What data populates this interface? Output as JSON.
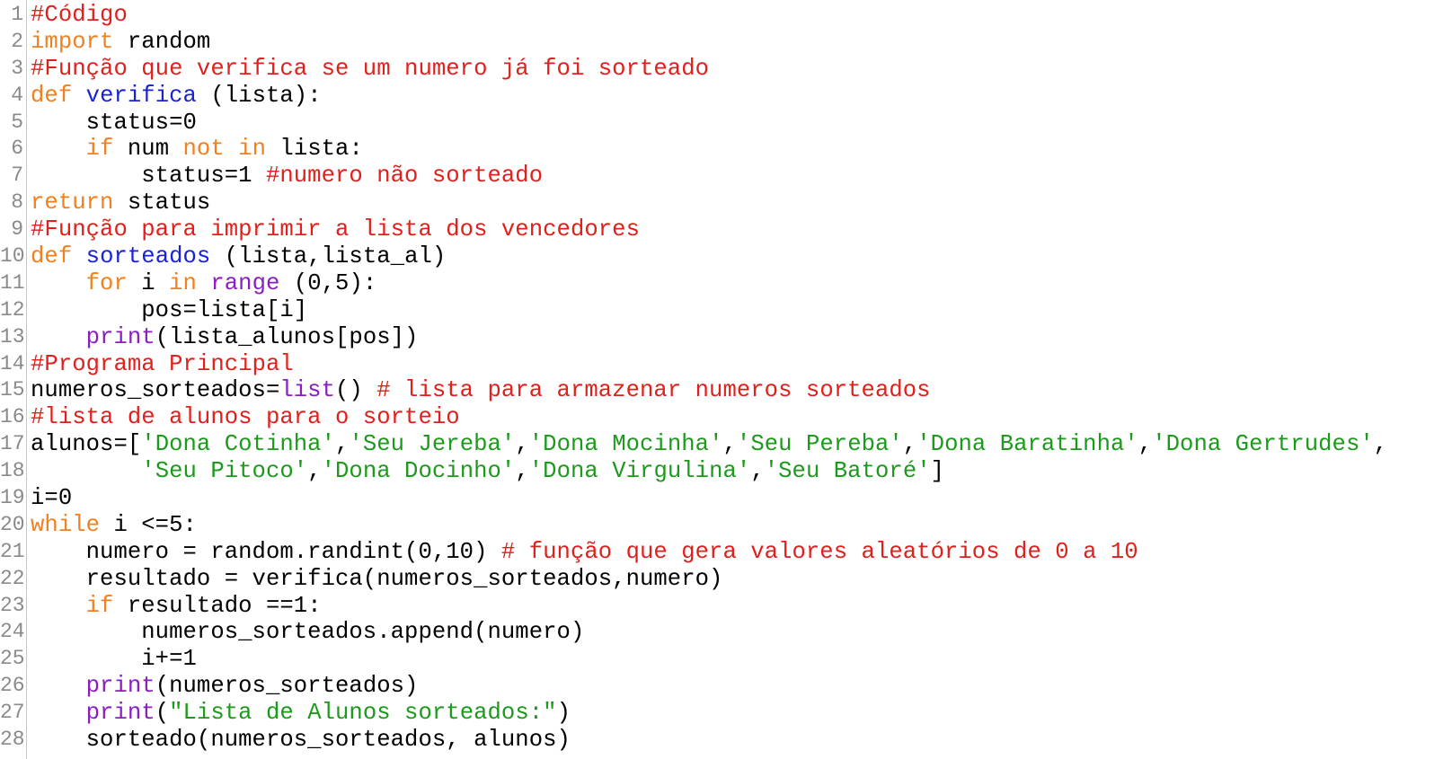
{
  "colors": {
    "comment": "#e0201c",
    "keyword": "#f08020",
    "funcname": "#1a22d8",
    "builtin": "#8a1ec0",
    "string": "#1c9a1c",
    "plain": "#000000",
    "line_number": "#8a8a8a"
  },
  "editor": {
    "lines": [
      {
        "number": "1",
        "tokens": [
          {
            "t": "comment",
            "s": "#Código"
          }
        ]
      },
      {
        "number": "2",
        "tokens": [
          {
            "t": "keyword",
            "s": "import"
          },
          {
            "t": "plain",
            "s": " random"
          }
        ]
      },
      {
        "number": "3",
        "tokens": [
          {
            "t": "comment",
            "s": "#Função que verifica se um numero já foi sorteado"
          }
        ]
      },
      {
        "number": "4",
        "tokens": [
          {
            "t": "keyword",
            "s": "def"
          },
          {
            "t": "plain",
            "s": " "
          },
          {
            "t": "funcname",
            "s": "verifica"
          },
          {
            "t": "plain",
            "s": " (lista):"
          }
        ]
      },
      {
        "number": "5",
        "tokens": [
          {
            "t": "plain",
            "s": "    status=0"
          }
        ]
      },
      {
        "number": "6",
        "tokens": [
          {
            "t": "plain",
            "s": "    "
          },
          {
            "t": "keyword",
            "s": "if"
          },
          {
            "t": "plain",
            "s": " num "
          },
          {
            "t": "keyword",
            "s": "not"
          },
          {
            "t": "plain",
            "s": " "
          },
          {
            "t": "keyword",
            "s": "in"
          },
          {
            "t": "plain",
            "s": " lista:"
          }
        ]
      },
      {
        "number": "7",
        "tokens": [
          {
            "t": "plain",
            "s": "        status=1 "
          },
          {
            "t": "comment",
            "s": "#numero não sorteado"
          }
        ]
      },
      {
        "number": "8",
        "tokens": [
          {
            "t": "keyword",
            "s": "return"
          },
          {
            "t": "plain",
            "s": " status"
          }
        ]
      },
      {
        "number": "9",
        "tokens": [
          {
            "t": "comment",
            "s": "#Função para imprimir a lista dos vencedores"
          }
        ]
      },
      {
        "number": "10",
        "tokens": [
          {
            "t": "keyword",
            "s": "def"
          },
          {
            "t": "plain",
            "s": " "
          },
          {
            "t": "funcname",
            "s": "sorteados"
          },
          {
            "t": "plain",
            "s": " (lista,lista_al)"
          }
        ]
      },
      {
        "number": "11",
        "tokens": [
          {
            "t": "plain",
            "s": "    "
          },
          {
            "t": "keyword",
            "s": "for"
          },
          {
            "t": "plain",
            "s": " i "
          },
          {
            "t": "keyword",
            "s": "in"
          },
          {
            "t": "plain",
            "s": " "
          },
          {
            "t": "builtin",
            "s": "range"
          },
          {
            "t": "plain",
            "s": " (0,5):"
          }
        ]
      },
      {
        "number": "12",
        "tokens": [
          {
            "t": "plain",
            "s": "        pos=lista[i]"
          }
        ]
      },
      {
        "number": "13",
        "tokens": [
          {
            "t": "plain",
            "s": "    "
          },
          {
            "t": "builtin",
            "s": "print"
          },
          {
            "t": "plain",
            "s": "(lista_alunos[pos])"
          }
        ]
      },
      {
        "number": "14",
        "tokens": [
          {
            "t": "comment",
            "s": "#Programa Principal"
          }
        ]
      },
      {
        "number": "15",
        "tokens": [
          {
            "t": "plain",
            "s": "numeros_sorteados="
          },
          {
            "t": "builtin",
            "s": "list"
          },
          {
            "t": "plain",
            "s": "() "
          },
          {
            "t": "comment",
            "s": "# lista para armazenar numeros sorteados"
          }
        ]
      },
      {
        "number": "16",
        "tokens": [
          {
            "t": "comment",
            "s": "#lista de alunos para o sorteio"
          }
        ]
      },
      {
        "number": "17",
        "tokens": [
          {
            "t": "plain",
            "s": "alunos=["
          },
          {
            "t": "string",
            "s": "'Dona Cotinha'"
          },
          {
            "t": "plain",
            "s": ","
          },
          {
            "t": "string",
            "s": "'Seu Jereba'"
          },
          {
            "t": "plain",
            "s": ","
          },
          {
            "t": "string",
            "s": "'Dona Mocinha'"
          },
          {
            "t": "plain",
            "s": ","
          },
          {
            "t": "string",
            "s": "'Seu Pereba'"
          },
          {
            "t": "plain",
            "s": ","
          },
          {
            "t": "string",
            "s": "'Dona Baratinha'"
          },
          {
            "t": "plain",
            "s": ","
          },
          {
            "t": "string",
            "s": "'Dona Gertrudes'"
          },
          {
            "t": "plain",
            "s": ","
          }
        ]
      },
      {
        "number": "18",
        "tokens": [
          {
            "t": "plain",
            "s": "        "
          },
          {
            "t": "string",
            "s": "'Seu Pitoco'"
          },
          {
            "t": "plain",
            "s": ","
          },
          {
            "t": "string",
            "s": "'Dona Docinho'"
          },
          {
            "t": "plain",
            "s": ","
          },
          {
            "t": "string",
            "s": "'Dona Virgulina'"
          },
          {
            "t": "plain",
            "s": ","
          },
          {
            "t": "string",
            "s": "'Seu Batoré'"
          },
          {
            "t": "plain",
            "s": "]"
          }
        ]
      },
      {
        "number": "19",
        "tokens": [
          {
            "t": "plain",
            "s": "i=0"
          }
        ]
      },
      {
        "number": "20",
        "tokens": [
          {
            "t": "keyword",
            "s": "while"
          },
          {
            "t": "plain",
            "s": " i <=5:"
          }
        ]
      },
      {
        "number": "21",
        "tokens": [
          {
            "t": "plain",
            "s": "    numero = random.randint(0,10) "
          },
          {
            "t": "comment",
            "s": "# função que gera valores aleatórios de 0 a 10"
          }
        ]
      },
      {
        "number": "22",
        "tokens": [
          {
            "t": "plain",
            "s": "    resultado = verifica(numeros_sorteados,numero)"
          }
        ]
      },
      {
        "number": "23",
        "tokens": [
          {
            "t": "plain",
            "s": "    "
          },
          {
            "t": "keyword",
            "s": "if"
          },
          {
            "t": "plain",
            "s": " resultado ==1:"
          }
        ]
      },
      {
        "number": "24",
        "tokens": [
          {
            "t": "plain",
            "s": "        numeros_sorteados.append(numero)"
          }
        ]
      },
      {
        "number": "25",
        "tokens": [
          {
            "t": "plain",
            "s": "        i+=1"
          }
        ]
      },
      {
        "number": "26",
        "tokens": [
          {
            "t": "plain",
            "s": "    "
          },
          {
            "t": "builtin",
            "s": "print"
          },
          {
            "t": "plain",
            "s": "(numeros_sorteados)"
          }
        ]
      },
      {
        "number": "27",
        "tokens": [
          {
            "t": "plain",
            "s": "    "
          },
          {
            "t": "builtin",
            "s": "print"
          },
          {
            "t": "plain",
            "s": "("
          },
          {
            "t": "string",
            "s": "\"Lista de Alunos sorteados:\""
          },
          {
            "t": "plain",
            "s": ")"
          }
        ]
      },
      {
        "number": "28",
        "tokens": [
          {
            "t": "plain",
            "s": "    sorteado(numeros_sorteados, alunos)"
          }
        ]
      }
    ]
  }
}
